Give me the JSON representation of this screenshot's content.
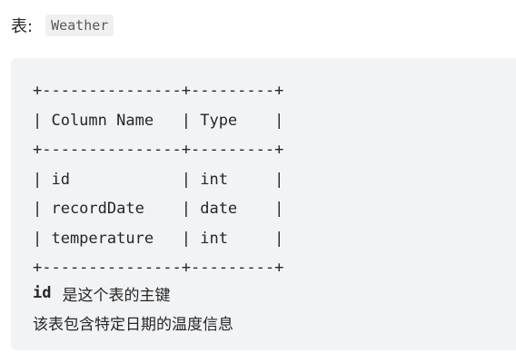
{
  "caption": {
    "label": "表:",
    "table_name": "Weather"
  },
  "schema_table": {
    "lines": [
      "+---------------+---------+",
      "| Column Name   | Type    |",
      "+---------------+---------+",
      "| id            | int     |",
      "| recordDate    | date    |",
      "| temperature   | int     |",
      "+---------------+---------+"
    ]
  },
  "notes": {
    "pk_column": "id",
    "pk_text": "是这个表的主键",
    "description": "该表包含特定日期的温度信息"
  }
}
